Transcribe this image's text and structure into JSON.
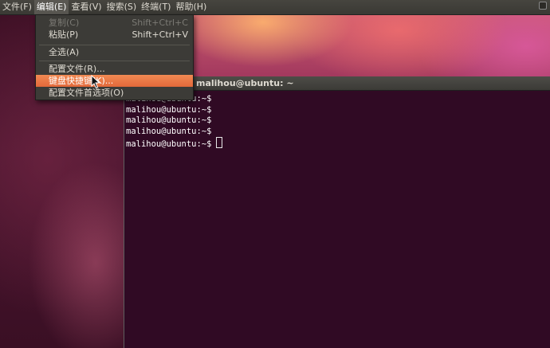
{
  "menubar": {
    "items": [
      {
        "label": "文件(F)"
      },
      {
        "label": "编辑(E)"
      },
      {
        "label": "查看(V)"
      },
      {
        "label": "搜索(S)"
      },
      {
        "label": "终端(T)"
      },
      {
        "label": "帮助(H)"
      }
    ]
  },
  "edit_menu": {
    "copy": {
      "label": "复制(C)",
      "accel": "Shift+Ctrl+C"
    },
    "paste": {
      "label": "粘贴(P)",
      "accel": "Shift+Ctrl+V"
    },
    "select_all": {
      "label": "全选(A)"
    },
    "profiles": {
      "label": "配置文件(R)..."
    },
    "shortcuts": {
      "label": "键盘快捷键(K)..."
    },
    "preferences": {
      "label": "配置文件首选项(O)"
    }
  },
  "terminal": {
    "title": "malihou@ubuntu: ~",
    "lines": [
      "malihou@ubuntu:~$",
      "malihou@ubuntu:~$",
      "malihou@ubuntu:~$",
      "malihou@ubuntu:~$",
      "malihou@ubuntu:~$"
    ]
  },
  "colors": {
    "highlight": "#e2683a",
    "terminal_bg": "#300a24"
  }
}
